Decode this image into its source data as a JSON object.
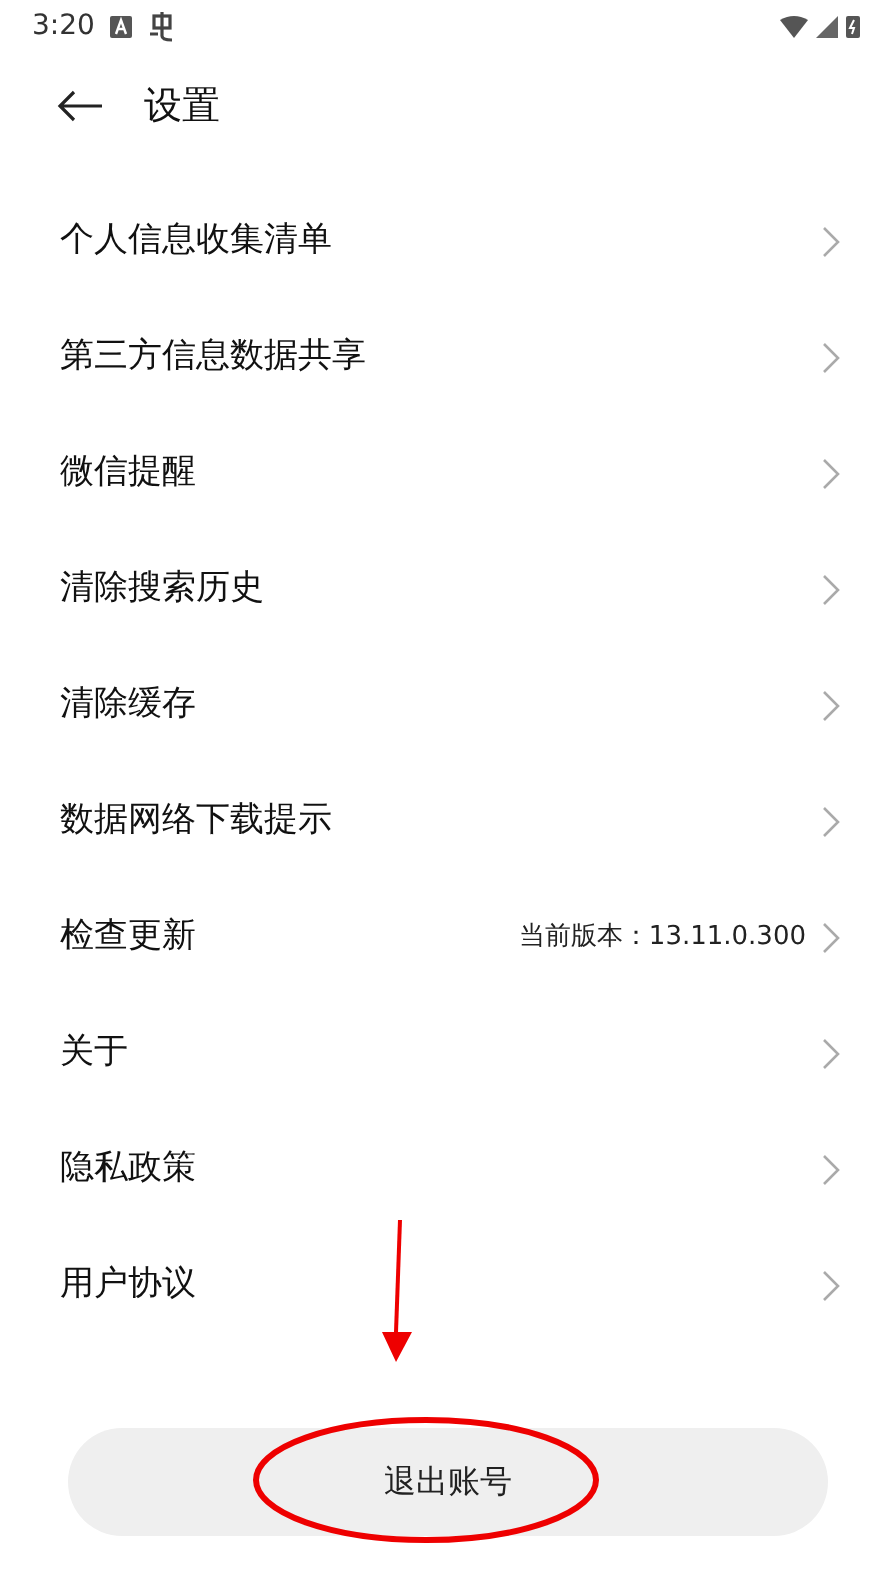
{
  "status_bar": {
    "time": "3:20"
  },
  "header": {
    "title": "设置"
  },
  "items": [
    {
      "label": "个人信息收集清单"
    },
    {
      "label": "第三方信息数据共享"
    },
    {
      "label": "微信提醒"
    },
    {
      "label": "清除搜索历史"
    },
    {
      "label": "清除缓存"
    },
    {
      "label": "数据网络下载提示"
    },
    {
      "label": "检查更新",
      "value": "当前版本：13.11.0.300"
    },
    {
      "label": "关于"
    },
    {
      "label": "隐私政策"
    },
    {
      "label": "用户协议"
    }
  ],
  "logout_button": {
    "label": "退出账号"
  }
}
